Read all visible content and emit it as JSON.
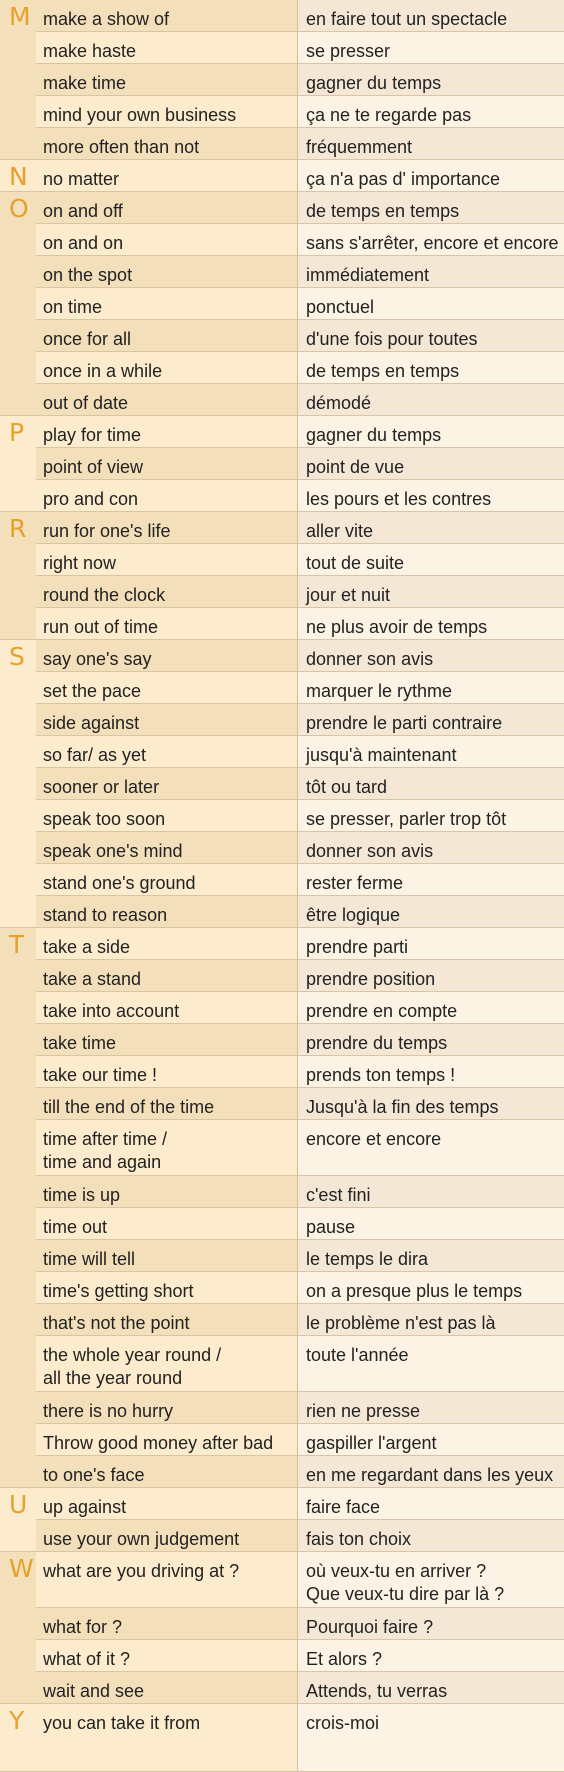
{
  "sections": [
    {
      "letter": "M",
      "entries": [
        {
          "en": "make a show of",
          "fr": "en faire tout un spectacle"
        },
        {
          "en": "make haste",
          "fr": "se presser"
        },
        {
          "en": "make time",
          "fr": "gagner du temps"
        },
        {
          "en": "mind your own business",
          "fr": "ça ne te regarde pas"
        },
        {
          "en": "more often than not",
          "fr": "fréquemment"
        }
      ]
    },
    {
      "letter": "N",
      "entries": [
        {
          "en": "no matter",
          "fr": "ça n'a pas d' importance"
        }
      ]
    },
    {
      "letter": "O",
      "entries": [
        {
          "en": "on and off",
          "fr": "de temps en temps"
        },
        {
          "en": "on and on",
          "fr": "sans s'arrêter, encore et encore"
        },
        {
          "en": "on the spot",
          "fr": "immédiatement"
        },
        {
          "en": "on time",
          "fr": "ponctuel"
        },
        {
          "en": "once for all",
          "fr": "d'une fois pour toutes"
        },
        {
          "en": "once in a while",
          "fr": "de temps en temps"
        },
        {
          "en": "out of date",
          "fr": "démodé"
        }
      ]
    },
    {
      "letter": "P",
      "entries": [
        {
          "en": "play for time",
          "fr": "gagner du temps"
        },
        {
          "en": "point of view",
          "fr": "point de vue"
        },
        {
          "en": "pro and con",
          "fr": "les pours et les contres"
        }
      ]
    },
    {
      "letter": "R",
      "entries": [
        {
          "en": "run for one's life",
          "fr": "aller vite"
        },
        {
          "en": "right now",
          "fr": "tout de suite"
        },
        {
          "en": "round the clock",
          "fr": "jour et nuit"
        },
        {
          "en": "run out of time",
          "fr": "ne plus avoir de temps"
        }
      ]
    },
    {
      "letter": "S",
      "entries": [
        {
          "en": "say one's say",
          "fr": "donner son avis"
        },
        {
          "en": "set the pace",
          "fr": "marquer le rythme"
        },
        {
          "en": "side against",
          "fr": "prendre le parti contraire"
        },
        {
          "en": "so far/ as yet",
          "fr": "jusqu'à maintenant"
        },
        {
          "en": "sooner or later",
          "fr": "tôt ou tard"
        },
        {
          "en": "speak too soon",
          "fr": "se presser, parler trop tôt"
        },
        {
          "en": "speak one's mind",
          "fr": "donner son avis"
        },
        {
          "en": "stand one's ground",
          "fr": "rester ferme"
        },
        {
          "en": "stand to reason",
          "fr": "être logique"
        }
      ]
    },
    {
      "letter": "T",
      "entries": [
        {
          "en": "take a side",
          "fr": "prendre parti"
        },
        {
          "en": "take a stand",
          "fr": "prendre position"
        },
        {
          "en": "take into account",
          "fr": "prendre en compte"
        },
        {
          "en": "take time",
          "fr": "prendre du temps"
        },
        {
          "en": "take our time !",
          "fr": "prends ton temps !"
        },
        {
          "en": "till the end of the time",
          "fr": "Jusqu'à la fin des temps"
        },
        {
          "en": "time after time /\ntime and again",
          "fr": "encore et encore"
        },
        {
          "en": "time is up",
          "fr": "c'est fini"
        },
        {
          "en": "time out",
          "fr": "pause"
        },
        {
          "en": "time will tell",
          "fr": "le temps le dira"
        },
        {
          "en": "time's getting short",
          "fr": "on a presque plus le temps"
        },
        {
          "en": "that's not the point",
          "fr": "le problème n'est pas là"
        },
        {
          "en": "the whole year round /\nall the year round",
          "fr": "toute l'année"
        },
        {
          "en": "there is no hurry",
          "fr": "rien ne presse"
        },
        {
          "en": "Throw good money after bad",
          "fr": "gaspiller l'argent"
        },
        {
          "en": "to one's face",
          "fr": "en me regardant dans les yeux"
        }
      ]
    },
    {
      "letter": "U",
      "entries": [
        {
          "en": "up against",
          "fr": "faire face"
        },
        {
          "en": "use your own judgement",
          "fr": "fais ton choix"
        }
      ]
    },
    {
      "letter": "W",
      "entries": [
        {
          "en": "what are you driving at ?",
          "fr": "où veux-tu en arriver ?\nQue veux-tu dire par là ?"
        },
        {
          "en": "what for ?",
          "fr": "Pourquoi faire ?"
        },
        {
          "en": "what of it ?",
          "fr": "Et alors ?"
        },
        {
          "en": "wait and see",
          "fr": "Attends, tu verras"
        }
      ]
    },
    {
      "letter": "Y",
      "entries": [
        {
          "en": "you can take it from",
          "fr": "crois-moi"
        }
      ]
    }
  ]
}
